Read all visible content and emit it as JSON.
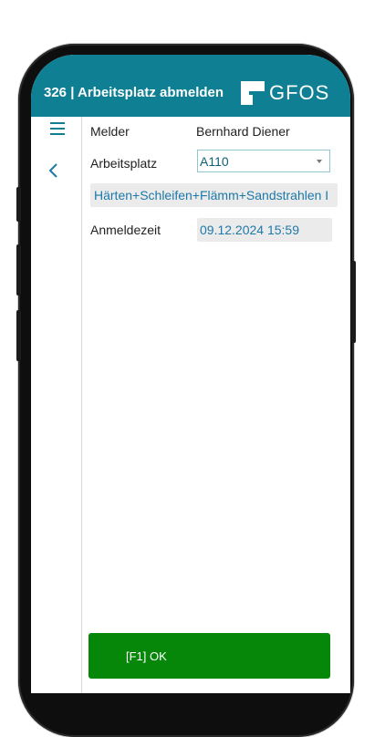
{
  "header": {
    "title": "326 | Arbeitsplatz abmelden",
    "logo_text": "GFOS",
    "color": "#0f7f93"
  },
  "nav": {
    "menu_icon": "hamburger-menu-icon",
    "back_icon": "chevron-left-icon"
  },
  "form": {
    "melder_label": "Melder",
    "melder_value": "Bernhard Diener",
    "arbeitsplatz_label": "Arbeitsplatz",
    "arbeitsplatz_value": "A110",
    "arbeitsplatz_description": "Härten+Schleifen+Flämm+Sandstrahlen I",
    "anmeldezeit_label": "Anmeldezeit",
    "anmeldezeit_value": "09.12.2024 15:59"
  },
  "actions": {
    "ok_label": "[F1] OK",
    "ok_color": "#06870a"
  }
}
